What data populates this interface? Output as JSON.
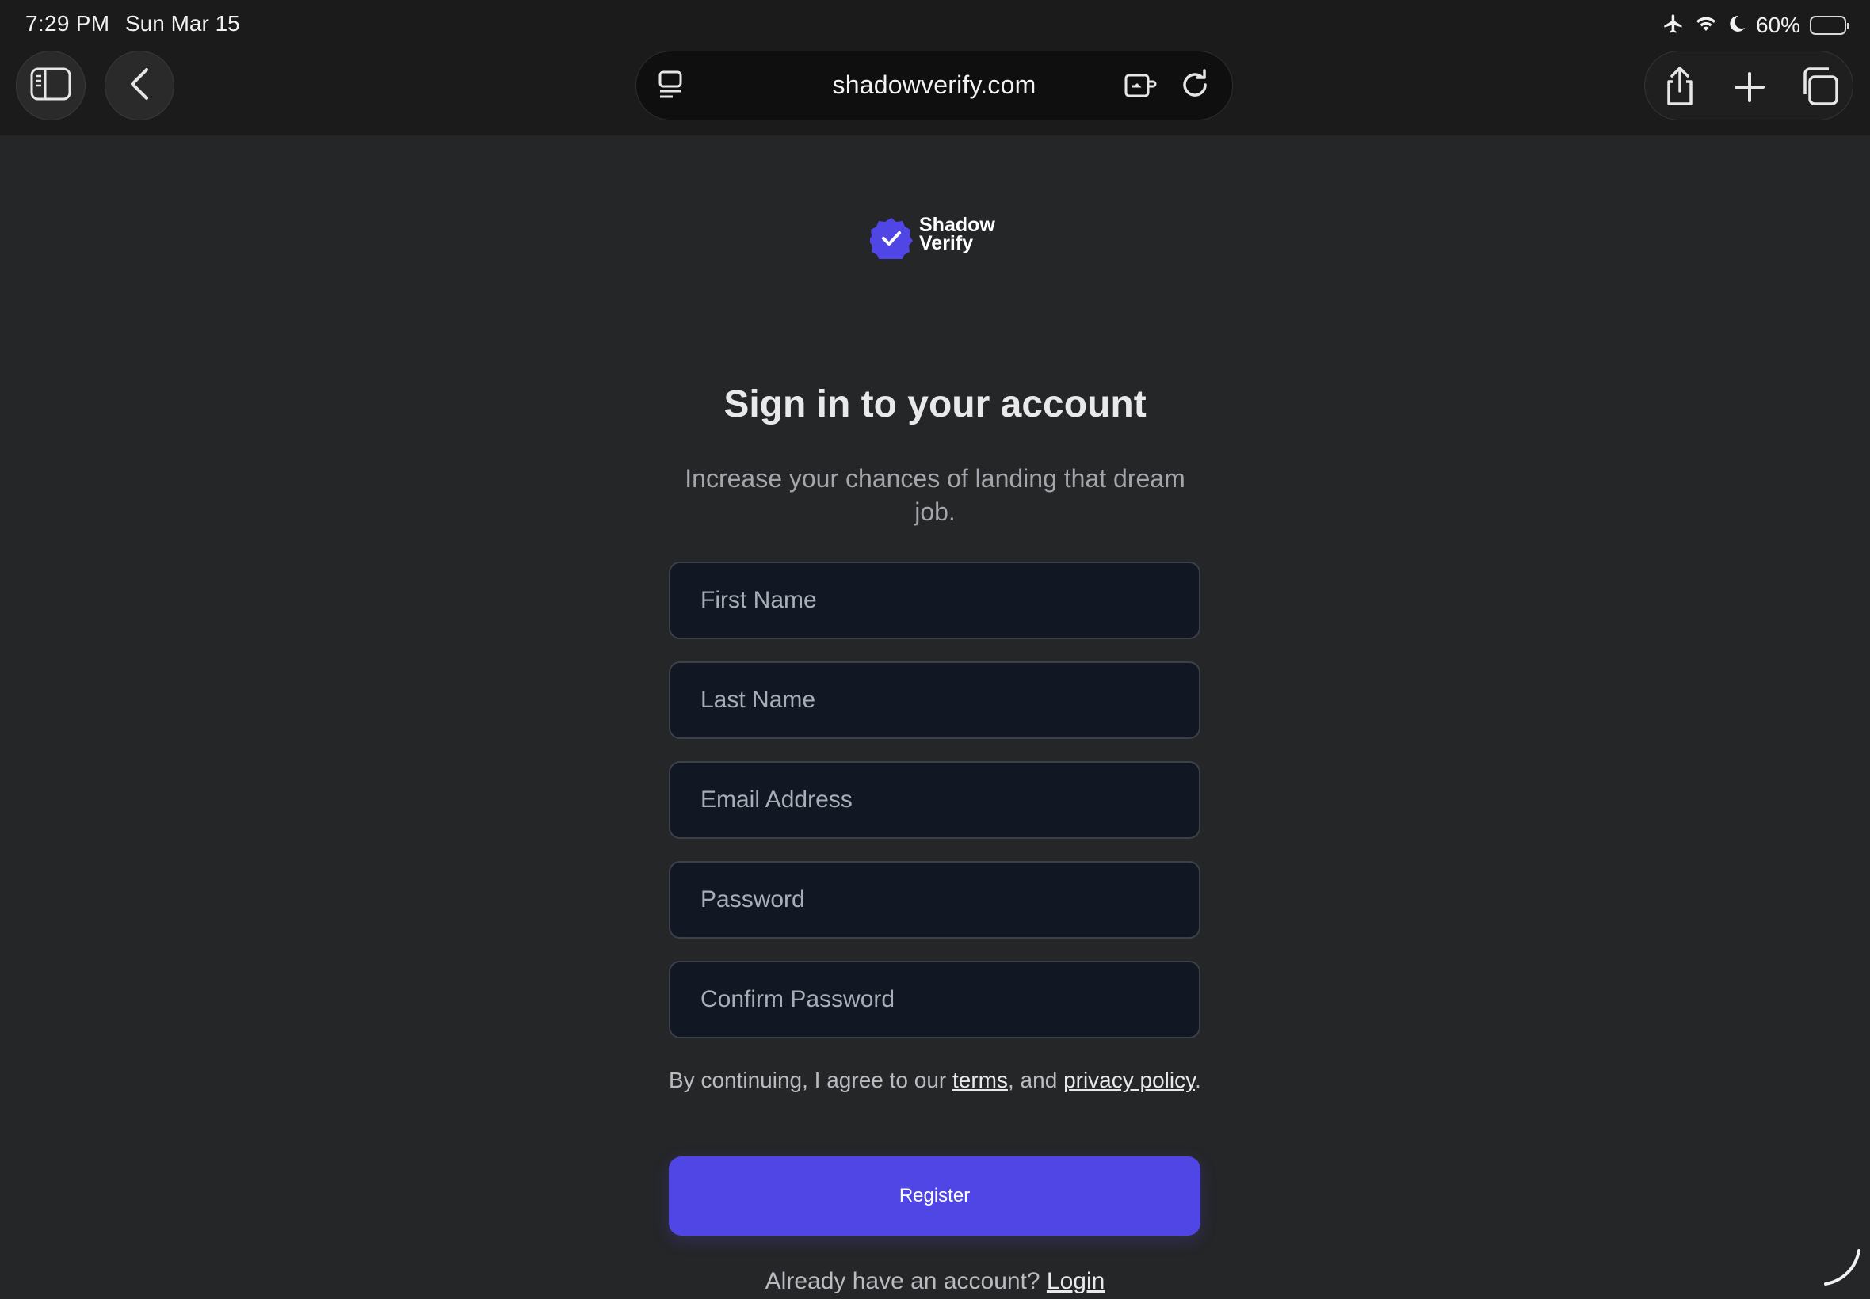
{
  "status_bar": {
    "time": "7:29 PM",
    "date": "Sun Mar 15",
    "battery_percent": "60%",
    "battery_level": 0.6
  },
  "toolbar": {
    "url": "shadowverify.com",
    "icons": [
      "sidebar-icon",
      "back-icon",
      "reader-icon",
      "extension-icon",
      "reload-icon",
      "share-icon",
      "new-tab-icon",
      "tabs-icon"
    ]
  },
  "brand": {
    "line1": "Shadow",
    "line2": "Verify",
    "accent": "#4f46e5"
  },
  "form": {
    "title": "Sign in to your account",
    "subtitle": "Increase your chances of landing that dream job.",
    "fields": {
      "first_name": "First Name",
      "last_name": "Last Name",
      "email": "Email Address",
      "password": "Password",
      "confirm_password": "Confirm Password"
    },
    "consent_prefix": "By continuing, I agree to our ",
    "terms_link": "terms",
    "consent_middle": ", and ",
    "privacy_link": "privacy policy",
    "consent_suffix": ".",
    "submit": "Register",
    "login_prompt": "Already have an account? ",
    "login_link": "Login"
  }
}
